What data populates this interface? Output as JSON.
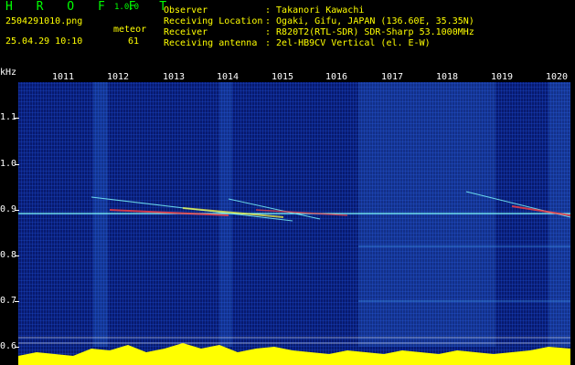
{
  "header": {
    "logo": "H R O F F T",
    "version": "1.0.0",
    "filename": "2504291010.png",
    "datetime": "25.04.29 10:10",
    "meteor_label": "meteor",
    "meteor_count": "61",
    "fields": [
      {
        "label": "Observer",
        "value": ": Takanori Kawachi"
      },
      {
        "label": "Receiving Location",
        "value": ": Ogaki, Gifu, JAPAN (136.60E, 35.35N)"
      },
      {
        "label": "Receiver",
        "value": ": R820T2(RTL-SDR) SDR-Sharp 53.1000MHz"
      },
      {
        "label": "Receiving antenna",
        "value": ": 2el-HB9CV Vertical (el. E-W)"
      }
    ]
  },
  "axes": {
    "y_unit": "kHz",
    "y_labels": [
      "1.1",
      "1.0",
      "0.9",
      "0.8",
      "0.7",
      "0.6"
    ],
    "x_labels": [
      "1011",
      "1012",
      "1013",
      "1014",
      "1015",
      "1016",
      "1017",
      "1018",
      "1019",
      "1020"
    ]
  },
  "colors": {
    "background": "#071a6e",
    "signal_line": "#80ffff",
    "meteor_hot": "#ff3030",
    "level_bar": "#ffff00"
  }
}
